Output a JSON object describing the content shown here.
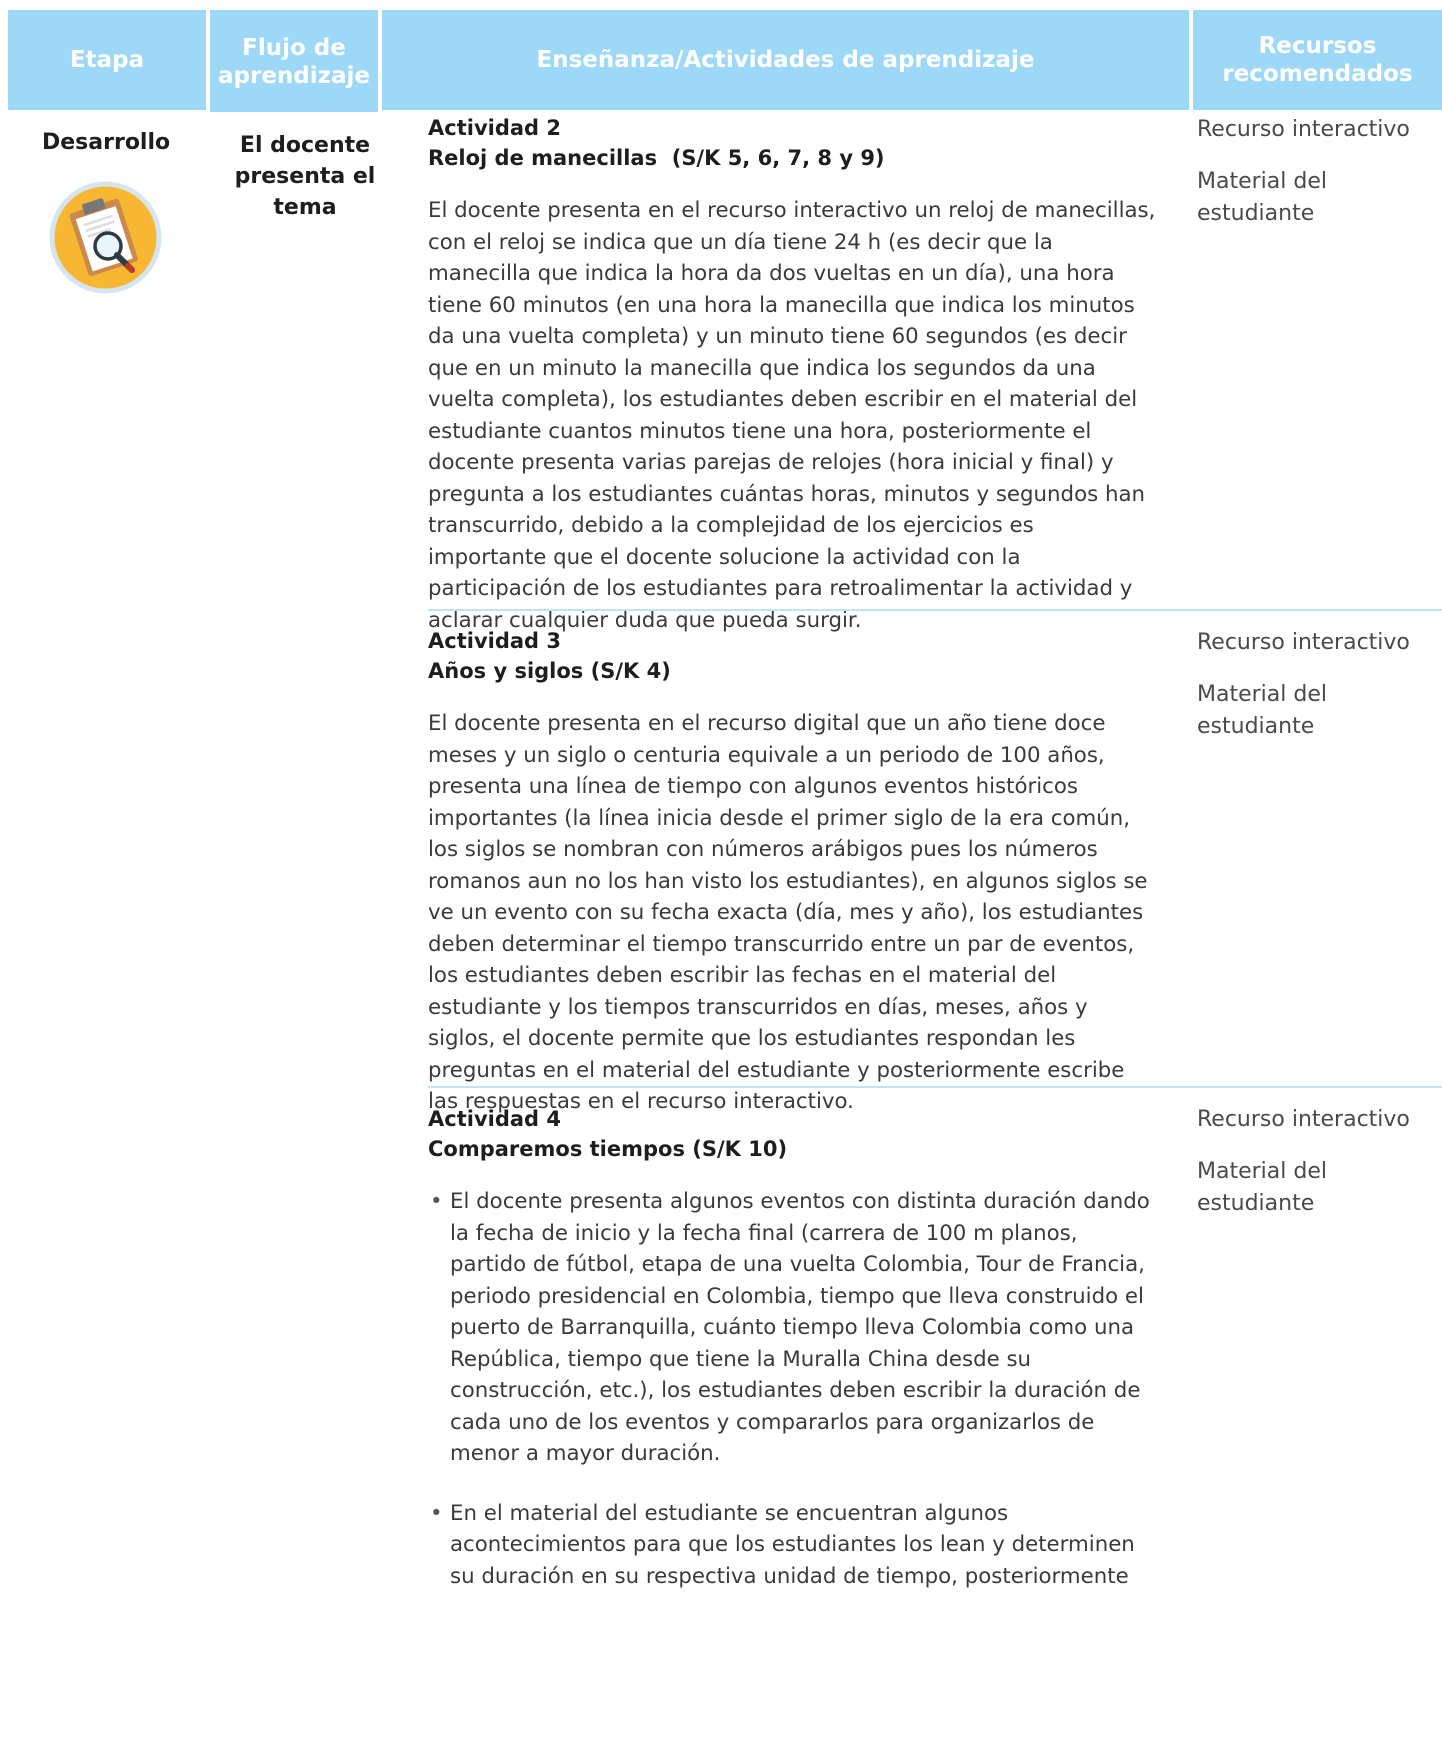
{
  "header": {
    "etapa": "Etapa",
    "flujo": "Flujo de aprendizaje",
    "ensenanza": "Enseñanza/Actividades de aprendizaje",
    "recursos": "Recursos recomendados"
  },
  "etapa": "Desarrollo",
  "flujo": "El docente presenta el tema",
  "icon": "clipboard-magnifier-icon",
  "colors": {
    "header_bg": "#9dd8f7",
    "header_text": "#ffffff",
    "divider": "#bfe4f6",
    "icon_circle": "#f7b733"
  },
  "activities": [
    {
      "number": "Actividad 2",
      "title": "Reloj de manecillas  (S/K 5, 6, 7, 8 y 9)",
      "body": "El docente presenta en el recurso interactivo un reloj de manecillas, con el reloj se indica que un día tiene 24 h (es decir que la manecilla que indica la hora da dos vueltas en un día), una hora tiene 60 minutos (en una hora la manecilla que indica los minutos da una vuelta completa) y un minuto tiene 60 segundos (es decir que en un minuto la manecilla que indica los segundos da una vuelta completa), los estudiantes deben escribir en el material del estudiante cuantos minutos tiene una hora, posteriormente el docente presenta varias parejas de relojes (hora inicial y final) y pregunta a los estudiantes cuántas horas, minutos y segundos han transcurrido, debido a la complejidad de los ejercicios es importante que el docente solucione la actividad con la participación de los estudiantes para retroalimentar la actividad y aclarar cualquier duda que pueda surgir.",
      "resources": [
        "Recurso interactivo",
        "Material del estudiante"
      ]
    },
    {
      "number": "Actividad 3",
      "title": "Años y siglos (S/K 4)",
      "body": "El docente presenta en el recurso digital que un año tiene doce meses y un siglo o centuria equivale a un periodo de 100 años, presenta una línea de tiempo con algunos eventos históricos importantes (la línea inicia desde el primer siglo de la era común, los siglos se nombran con números arábigos pues los números romanos aun no los han visto los estudiantes), en algunos siglos se ve un evento con su fecha exacta (día, mes y año), los estudiantes deben determinar el tiempo transcurrido entre un par de eventos, los estudiantes deben escribir las fechas en el material del estudiante y los tiempos transcurridos en días, meses, años y siglos, el docente permite que los estudiantes respondan les preguntas en el material del estudiante y posteriormente escribe las respuestas en el recurso interactivo.",
      "resources": [
        "Recurso interactivo",
        "Material del estudiante"
      ]
    },
    {
      "number": "Actividad 4",
      "title": "Comparemos tiempos (S/K 10)",
      "bullets": [
        "El docente presenta algunos eventos con distinta duración dando la fecha de inicio y la fecha final (carrera de 100 m planos, partido de fútbol, etapa de una vuelta Colombia, Tour de Francia, periodo presidencial en Colombia, tiempo que lleva construido el puerto de Barranquilla, cuánto tiempo lleva Colombia como una República, tiempo que tiene la Muralla China desde su construcción, etc.), los estudiantes deben escribir la duración de cada uno de los eventos y compararlos para organizarlos de menor a mayor duración.",
        "En el material del estudiante se encuentran algunos acontecimientos para que los estudiantes los lean y determinen su duración en su respectiva unidad de tiempo, posteriormente"
      ],
      "resources": [
        "Recurso interactivo",
        "Material del estudiante"
      ]
    }
  ]
}
